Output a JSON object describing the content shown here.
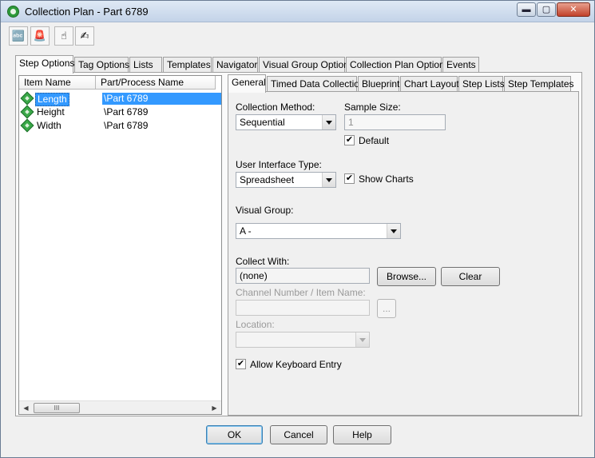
{
  "window": {
    "title": "Collection Plan - Part 6789",
    "close_glyph": "✕",
    "minimize_glyph": "▬",
    "maximize_glyph": "▢"
  },
  "toolbar": {
    "buttons": [
      {
        "icon": "abc-spell-icon",
        "glyph": "🔤"
      },
      {
        "icon": "alarm-icon",
        "glyph": "🚨"
      },
      {
        "icon": "hand-pointer-icon",
        "glyph": "☝"
      },
      {
        "icon": "hand-point-icon",
        "glyph": "✍"
      }
    ]
  },
  "outer_tabs": [
    "Step Options",
    "Tag Options",
    "Lists",
    "Templates",
    "Navigator",
    "Visual Group Options",
    "Collection Plan Options",
    "Events"
  ],
  "list": {
    "columns": [
      "Item Name",
      "Part/Process Name"
    ],
    "rows": [
      {
        "name": "Length",
        "part": "\\Part 6789",
        "selected": true
      },
      {
        "name": "Height",
        "part": "\\Part 6789",
        "selected": false
      },
      {
        "name": "Width",
        "part": "\\Part 6789",
        "selected": false
      }
    ],
    "scroll_left": "◀",
    "scroll_right": "▶",
    "scroll_grip": "III"
  },
  "inner_tabs": [
    "General",
    "Timed Data Collection",
    "Blueprint",
    "Chart Layout",
    "Step Lists",
    "Step Templates"
  ],
  "general": {
    "collection_method_label": "Collection Method:",
    "collection_method_value": "Sequential",
    "sample_size_label": "Sample Size:",
    "sample_size_value": "1",
    "default_label": "Default",
    "default_checked": true,
    "ui_type_label": "User Interface Type:",
    "ui_type_value": "Spreadsheet",
    "show_charts_label": "Show Charts",
    "show_charts_checked": true,
    "visual_group_label": "Visual Group:",
    "visual_group_value": "A -",
    "collect_with_label": "Collect With:",
    "collect_with_value": "(none)",
    "browse_label": "Browse...",
    "clear_label": "Clear",
    "channel_label": "Channel Number / Item Name:",
    "channel_value": "",
    "ellipsis_label": "...",
    "location_label": "Location:",
    "location_value": "",
    "allow_keyboard_label": "Allow Keyboard Entry",
    "allow_keyboard_checked": true,
    "check_glyph": "✔"
  },
  "footer": {
    "ok_label": "OK",
    "cancel_label": "Cancel",
    "help_label": "Help"
  }
}
